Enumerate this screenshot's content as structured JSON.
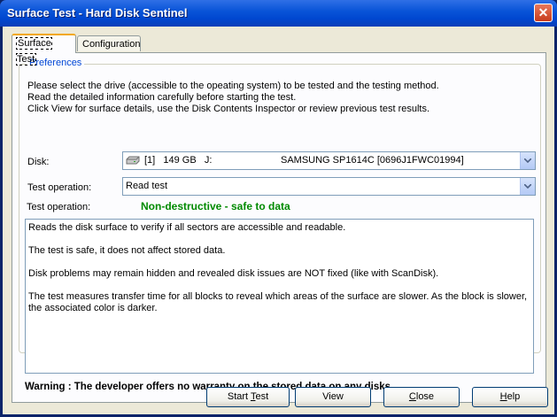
{
  "window": {
    "title": "Surface Test - Hard Disk Sentinel",
    "close_symbol": "✕"
  },
  "tabs": [
    {
      "label": "Surface Test",
      "active": true
    },
    {
      "label": "Configuration",
      "active": false
    }
  ],
  "preferences": {
    "group_title": "Preferences",
    "intro_lines": [
      "Please select the drive (accessible to the opeating system) to be tested and the testing method.",
      "Read the detailed information carefully before starting the test.",
      "Click View for surface details, use the Disk Contents Inspector or review previous test results."
    ],
    "disk_label": "Disk:",
    "disk_value": "[1]   149 GB   J:",
    "disk_model": "SAMSUNG SP1614C [0696J1FWC01994]",
    "operation_label": "Test operation:",
    "operation_value": "Read test",
    "operation_label_2": "Test operation:",
    "operation_status": "Non-destructive - safe to data",
    "status_color": "#008a00"
  },
  "description": [
    "Reads the disk surface to verify if all sectors are accessible and readable.",
    "The test is safe, it does not affect stored data.",
    "Disk problems may remain hidden and revealed disk issues are NOT fixed (like with ScanDisk).",
    "The test measures transfer time for all blocks to reveal which areas of the surface are slower. As the block is slower, the associated color is darker."
  ],
  "warning": "Warning : The developer offers no warranty on the stored data on any disks.",
  "buttons": {
    "start_pre": "Start ",
    "start_accel": "T",
    "start_post": "est",
    "view": "View",
    "close_accel": "C",
    "close_post": "lose",
    "help_accel": "H",
    "help_post": "elp"
  },
  "icons": {
    "disk": "hard-disk-icon",
    "dropdown": "chevron-down-icon",
    "close": "close-icon"
  },
  "colors": {
    "titlebar": "#0054e3",
    "face": "#ece9d8",
    "group_title": "#0046d5"
  }
}
